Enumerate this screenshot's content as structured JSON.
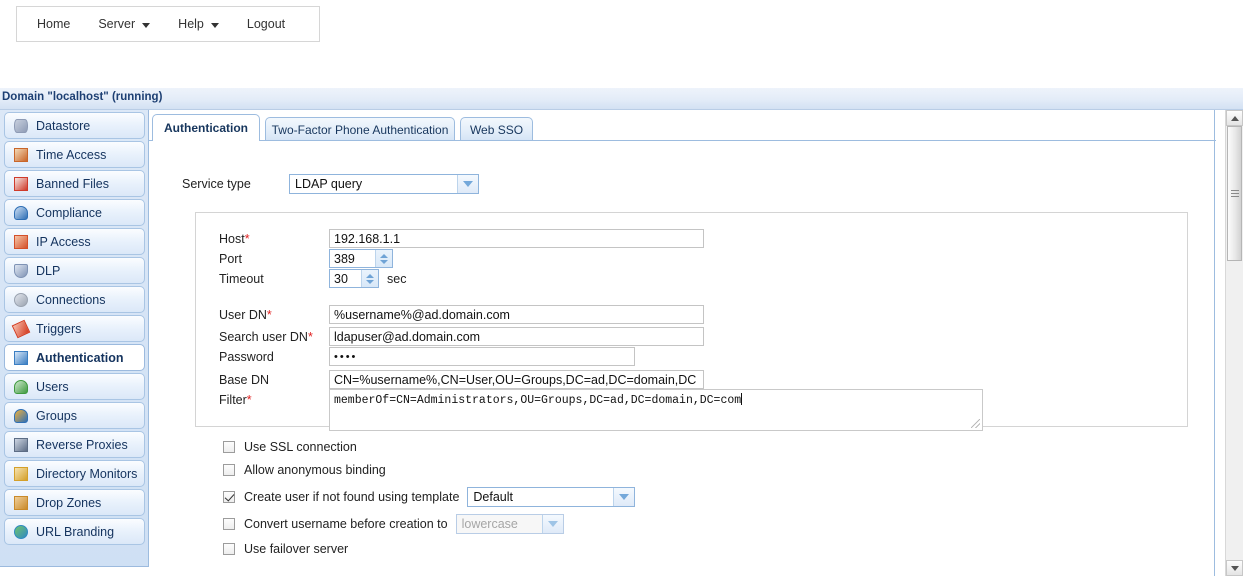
{
  "topmenu": {
    "items": [
      {
        "label": "Home",
        "caret": false
      },
      {
        "label": "Server",
        "caret": true
      },
      {
        "label": "Help",
        "caret": true
      },
      {
        "label": "Logout",
        "caret": false
      }
    ]
  },
  "domain_bar": {
    "text": "Domain \"localhost\" (running)"
  },
  "sidebar": {
    "items": [
      {
        "label": "Datastore",
        "icon": "datastore-icon",
        "active": false
      },
      {
        "label": "Time Access",
        "icon": "calendar-clock-icon",
        "active": false
      },
      {
        "label": "Banned Files",
        "icon": "banned-file-icon",
        "active": false
      },
      {
        "label": "Compliance",
        "icon": "user-shield-icon",
        "active": false
      },
      {
        "label": "IP Access",
        "icon": "firewall-icon",
        "active": false
      },
      {
        "label": "DLP",
        "icon": "shield-icon",
        "active": false
      },
      {
        "label": "Connections",
        "icon": "gears-icon",
        "active": false
      },
      {
        "label": "Triggers",
        "icon": "lightning-arrow-icon",
        "active": false
      },
      {
        "label": "Authentication",
        "icon": "id-card-icon",
        "active": true
      },
      {
        "label": "Users",
        "icon": "user-icon",
        "active": false
      },
      {
        "label": "Groups",
        "icon": "users-group-icon",
        "active": false
      },
      {
        "label": "Reverse Proxies",
        "icon": "servers-icon",
        "active": false
      },
      {
        "label": "Directory Monitors",
        "icon": "folder-clock-icon",
        "active": false
      },
      {
        "label": "Drop Zones",
        "icon": "package-icon",
        "active": false
      },
      {
        "label": "URL Branding",
        "icon": "globe-icon",
        "active": false
      }
    ]
  },
  "tabs": [
    {
      "label": "Authentication",
      "active": true
    },
    {
      "label": "Two-Factor Phone Authentication",
      "active": false
    },
    {
      "label": "Web SSO",
      "active": false
    }
  ],
  "form": {
    "service_type": {
      "label": "Service type",
      "value": "LDAP query"
    },
    "fields": [
      {
        "label": "Host",
        "required": true,
        "value": "192.168.1.1",
        "type": "text"
      },
      {
        "label": "Port",
        "required": false,
        "value": "389",
        "type": "spinner"
      },
      {
        "label": "Timeout",
        "required": false,
        "value": "30",
        "suffix": "sec",
        "type": "spinner"
      },
      {
        "label": "User DN",
        "required": true,
        "value": "%username%@ad.domain.com",
        "type": "text"
      },
      {
        "label": "Search user DN",
        "required": true,
        "value": "ldapuser@ad.domain.com",
        "type": "text"
      },
      {
        "label": "Password",
        "required": false,
        "value": "••••",
        "type": "password"
      },
      {
        "label": "Base DN",
        "required": false,
        "value": "CN=%username%,CN=User,OU=Groups,DC=ad,DC=domain,DC",
        "type": "text"
      },
      {
        "label": "Filter",
        "required": true,
        "value": "memberOf=CN=Administrators,OU=Groups,DC=ad,DC=domain,DC=com",
        "type": "textarea"
      }
    ],
    "options": [
      {
        "label": "Use SSL connection",
        "checked": false
      },
      {
        "label": "Allow anonymous binding",
        "checked": false
      },
      {
        "label": "Create user if not found using template",
        "checked": true,
        "select": {
          "value": "Default",
          "disabled": false
        }
      },
      {
        "label": "Convert username before creation to",
        "checked": false,
        "select": {
          "value": "lowercase",
          "disabled": true
        }
      },
      {
        "label": "Use failover server",
        "checked": false
      }
    ]
  },
  "scrollbar": {
    "up_icon": "scroll-up-arrow-icon",
    "down_icon": "scroll-down-arrow-icon",
    "thumb_icon": "scroll-thumb-grip-icon"
  },
  "colors": {
    "accent_blue": "#17365d",
    "header_strip": "#dce8f7",
    "required_star": "#e02020",
    "sidebar_bg": "#cfe0f4"
  }
}
